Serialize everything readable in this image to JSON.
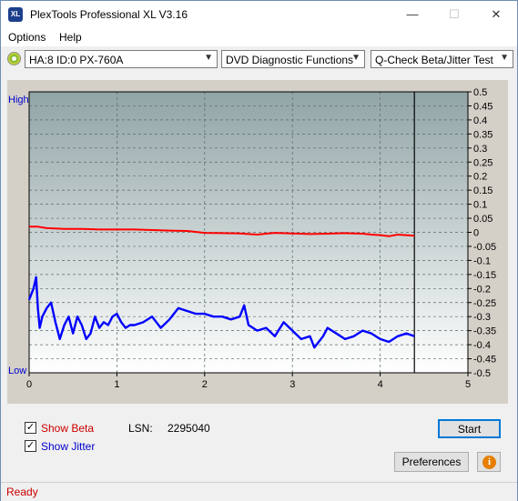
{
  "window": {
    "title": "PlexTools Professional XL V3.16",
    "icon_label": "XL",
    "minimize_glyph": "—",
    "maximize_glyph": "☐",
    "close_glyph": "✕"
  },
  "menu": {
    "options_label": "Options",
    "help_label": "Help"
  },
  "toolbar": {
    "drive_value": "HA:8 ID:0  PX-760A",
    "function_value": "DVD Diagnostic Functions",
    "test_value": "Q-Check Beta/Jitter Test",
    "drive_icon": "disc-icon",
    "dropdown_icon": "chevron-down-icon"
  },
  "chart_data": {
    "type": "line",
    "left_axis_labels": {
      "top": "High",
      "bottom": "Low"
    },
    "x_ticks": [
      "0",
      "1",
      "2",
      "3",
      "4",
      "5"
    ],
    "xlim": [
      0,
      5
    ],
    "y_right_ticks": [
      "0.5",
      "0.45",
      "0.4",
      "0.35",
      "0.3",
      "0.25",
      "0.2",
      "0.15",
      "0.1",
      "0.05",
      "0",
      "-0.05",
      "-0.1",
      "-0.15",
      "-0.2",
      "-0.25",
      "-0.3",
      "-0.35",
      "-0.4",
      "-0.45",
      "-0.5"
    ],
    "ylim": [
      -0.5,
      0.5
    ],
    "end_marker_x": 4.39,
    "grid": true,
    "series": [
      {
        "color": "#ff0000",
        "x": [
          0,
          0.1,
          0.2,
          0.4,
          0.6,
          0.8,
          1.0,
          1.2,
          1.4,
          1.6,
          1.8,
          2.0,
          2.2,
          2.4,
          2.6,
          2.7,
          2.8,
          3.0,
          3.2,
          3.4,
          3.6,
          3.8,
          3.9,
          4.0,
          4.1,
          4.2,
          4.39
        ],
        "values": [
          0.02,
          0.02,
          0.015,
          0.012,
          0.012,
          0.01,
          0.01,
          0.01,
          0.008,
          0.006,
          0.005,
          -0.002,
          -0.003,
          -0.004,
          -0.008,
          -0.005,
          -0.002,
          -0.004,
          -0.006,
          -0.005,
          -0.003,
          -0.005,
          -0.008,
          -0.01,
          -0.014,
          -0.008,
          -0.012
        ]
      },
      {
        "color": "#0000ff",
        "x": [
          0,
          0.05,
          0.08,
          0.1,
          0.12,
          0.15,
          0.2,
          0.25,
          0.3,
          0.35,
          0.4,
          0.45,
          0.5,
          0.55,
          0.6,
          0.65,
          0.7,
          0.75,
          0.8,
          0.85,
          0.9,
          0.95,
          1.0,
          1.05,
          1.1,
          1.15,
          1.2,
          1.3,
          1.4,
          1.5,
          1.6,
          1.7,
          1.8,
          1.9,
          2.0,
          2.1,
          2.2,
          2.3,
          2.4,
          2.45,
          2.5,
          2.6,
          2.7,
          2.8,
          2.9,
          3.0,
          3.1,
          3.2,
          3.25,
          3.3,
          3.35,
          3.4,
          3.5,
          3.6,
          3.7,
          3.8,
          3.9,
          4.0,
          4.1,
          4.2,
          4.3,
          4.39
        ],
        "values": [
          -0.24,
          -0.2,
          -0.16,
          -0.27,
          -0.34,
          -0.3,
          -0.27,
          -0.25,
          -0.32,
          -0.38,
          -0.33,
          -0.3,
          -0.36,
          -0.3,
          -0.33,
          -0.38,
          -0.36,
          -0.3,
          -0.34,
          -0.32,
          -0.33,
          -0.3,
          -0.29,
          -0.32,
          -0.34,
          -0.33,
          -0.33,
          -0.32,
          -0.3,
          -0.34,
          -0.31,
          -0.27,
          -0.28,
          -0.29,
          -0.29,
          -0.3,
          -0.3,
          -0.31,
          -0.3,
          -0.26,
          -0.33,
          -0.35,
          -0.34,
          -0.37,
          -0.32,
          -0.35,
          -0.38,
          -0.37,
          -0.41,
          -0.39,
          -0.37,
          -0.34,
          -0.36,
          -0.38,
          -0.37,
          -0.35,
          -0.36,
          -0.38,
          -0.39,
          -0.37,
          -0.36,
          -0.37
        ]
      }
    ]
  },
  "controls": {
    "show_beta_label": "Show Beta",
    "show_jitter_label": "Show Jitter",
    "show_beta_checked": "✓",
    "show_jitter_checked": "✓",
    "lsn_label": "LSN:",
    "lsn_value": "2295040",
    "start_label": "Start",
    "preferences_label": "Preferences",
    "info_glyph": "i",
    "beta_color": "#cc0000",
    "jitter_color": "#0000cc"
  },
  "status": {
    "text": "Ready"
  }
}
